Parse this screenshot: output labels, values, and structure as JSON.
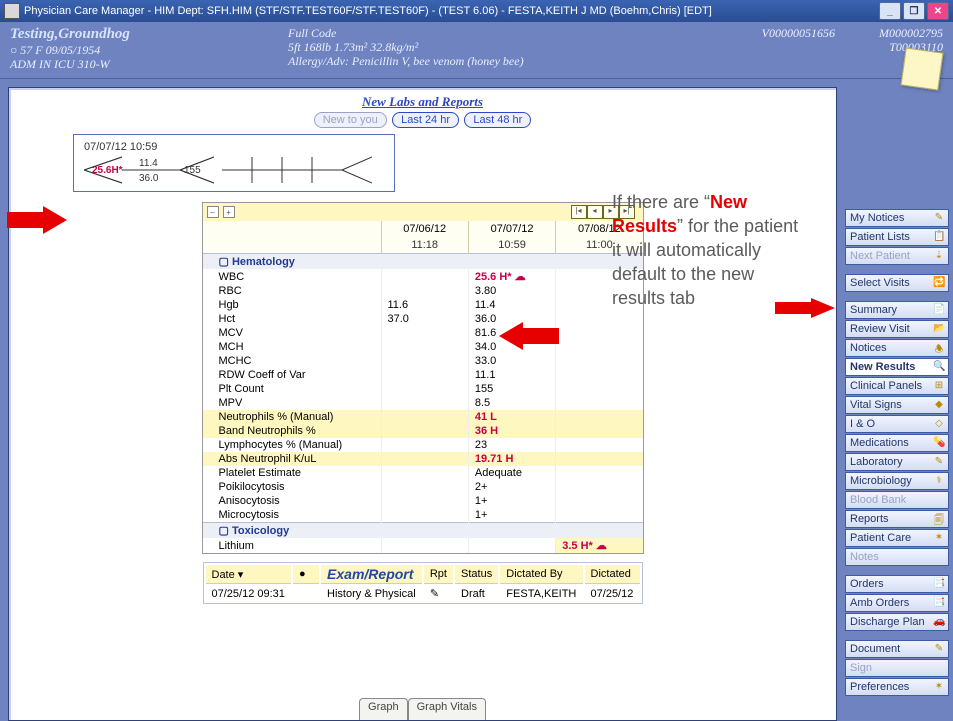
{
  "window": {
    "title": "Physician Care Manager - HIM Dept: SFH.HIM (STF/STF.TEST60F/STF.TEST60F) - (TEST 6.06) - FESTA,KEITH J MD (Boehm,Chris) [EDT]"
  },
  "patient": {
    "name": "Testing,Groundhog",
    "line2": "○  57  F  09/05/1954",
    "line3": "ADM IN  ICU  310-W",
    "code": "Full Code",
    "phys": "5ft  168lb  1.73m²  32.8kg/m²",
    "allergy": "Allergy/Adv: Penicillin V, bee venom (honey bee)",
    "visit": "V00000051656",
    "id1": "M000002795",
    "id2": "T00003110"
  },
  "labs": {
    "title": "New Labs and Reports",
    "tabs": [
      "New to you",
      "Last 24 hr",
      "Last 48 hr"
    ],
    "fishbone": {
      "timestamp": "07/07/12 10:59",
      "wbc": "25.6H*",
      "hgb": "11.4",
      "hct": "36.0",
      "plt": "155"
    },
    "columns": [
      {
        "date": "07/06/12",
        "time": "11:18"
      },
      {
        "date": "07/07/12",
        "time": "10:59"
      },
      {
        "date": "07/08/12",
        "time": "11:00"
      }
    ],
    "groups": [
      {
        "name": "Hematology",
        "rows": [
          {
            "label": "WBC",
            "c": [
              "",
              "25.6  H* ☁",
              ""
            ],
            "abn": [
              false,
              true,
              false
            ]
          },
          {
            "label": "RBC",
            "c": [
              "",
              "3.80",
              ""
            ]
          },
          {
            "label": "Hgb",
            "c": [
              "11.6",
              "11.4",
              ""
            ]
          },
          {
            "label": "Hct",
            "c": [
              "37.0",
              "36.0",
              ""
            ]
          },
          {
            "label": "MCV",
            "c": [
              "",
              "81.6",
              ""
            ]
          },
          {
            "label": "MCH",
            "c": [
              "",
              "34.0",
              ""
            ]
          },
          {
            "label": "MCHC",
            "c": [
              "",
              "33.0",
              ""
            ]
          },
          {
            "label": "RDW Coeff of Var",
            "c": [
              "",
              "11.1",
              ""
            ]
          },
          {
            "label": "Plt Count",
            "c": [
              "",
              "155",
              ""
            ]
          },
          {
            "label": "MPV",
            "c": [
              "",
              "8.5",
              ""
            ]
          },
          {
            "label": "Neutrophils % (Manual)",
            "c": [
              "",
              "41  L",
              ""
            ],
            "hl": true,
            "abn": [
              false,
              true,
              false
            ]
          },
          {
            "label": "Band Neutrophils %",
            "c": [
              "",
              "36  H",
              ""
            ],
            "hl": true,
            "abn": [
              false,
              true,
              false
            ]
          },
          {
            "label": "Lymphocytes % (Manual)",
            "c": [
              "",
              "23",
              ""
            ]
          },
          {
            "label": "Abs Neutrophil K/uL",
            "c": [
              "",
              "19.71  H",
              ""
            ],
            "hl": true,
            "abn": [
              false,
              true,
              false
            ]
          },
          {
            "label": "Platelet Estimate",
            "c": [
              "",
              "Adequate",
              ""
            ]
          },
          {
            "label": "Poikilocytosis",
            "c": [
              "",
              "2+",
              ""
            ]
          },
          {
            "label": "Anisocytosis",
            "c": [
              "",
              "1+",
              ""
            ]
          },
          {
            "label": "Microcytosis",
            "c": [
              "",
              "1+",
              ""
            ]
          }
        ]
      },
      {
        "name": "Toxicology",
        "rows": [
          {
            "label": "Lithium",
            "c": [
              "",
              "",
              "3.5  H* ☁"
            ],
            "hl3": true,
            "abn": [
              false,
              false,
              true
            ]
          }
        ]
      }
    ]
  },
  "report": {
    "headers": [
      "Date ▾",
      "",
      "Exam/Report",
      "Rpt",
      "Status",
      "Dictated By",
      "Dictated"
    ],
    "row": {
      "date": "07/25/12 09:31",
      "exam": "History & Physical",
      "rpt": "✎",
      "status": "Draft",
      "by": "FESTA,KEITH",
      "dictated": "07/25/12"
    }
  },
  "annotation": {
    "text1": "If there are “",
    "hl": "New Results",
    "text2": "” for the patient it will automatically default to the new results tab"
  },
  "bottomTabs": [
    "Graph",
    "Graph Vitals"
  ],
  "rightnav": [
    [
      {
        "label": "My Notices",
        "i": "✎"
      },
      {
        "label": "Patient Lists",
        "i": "📋"
      },
      {
        "label": "Next Patient",
        "i": "⇣",
        "disabled": true
      }
    ],
    [
      {
        "label": "Select Visits",
        "i": "🔁"
      }
    ],
    [
      {
        "label": "Summary",
        "i": "📄"
      },
      {
        "label": "Review Visit",
        "i": "📂"
      },
      {
        "label": "Notices",
        "i": "🕭"
      },
      {
        "label": "New Results",
        "i": "🔍",
        "selected": true
      },
      {
        "label": "Clinical Panels",
        "i": "⊞"
      },
      {
        "label": "Vital Signs",
        "i": "◆"
      },
      {
        "label": "I & O",
        "i": "◇"
      },
      {
        "label": "Medications",
        "i": "💊"
      },
      {
        "label": "Laboratory",
        "i": "✎"
      },
      {
        "label": "Microbiology",
        "i": "⚕"
      },
      {
        "label": "Blood Bank",
        "i": "",
        "disabled": true
      },
      {
        "label": "Reports",
        "i": "🗐"
      },
      {
        "label": "Patient Care",
        "i": "✶"
      },
      {
        "label": "Notes",
        "i": "",
        "disabled": true
      }
    ],
    [
      {
        "label": "Orders",
        "i": "📑"
      },
      {
        "label": "Amb Orders",
        "i": "📑"
      },
      {
        "label": "Discharge Plan",
        "i": "🚗"
      }
    ],
    [
      {
        "label": "Document",
        "i": "✎"
      },
      {
        "label": "Sign",
        "i": "",
        "disabled": true
      },
      {
        "label": "Preferences",
        "i": "✶"
      }
    ]
  ]
}
